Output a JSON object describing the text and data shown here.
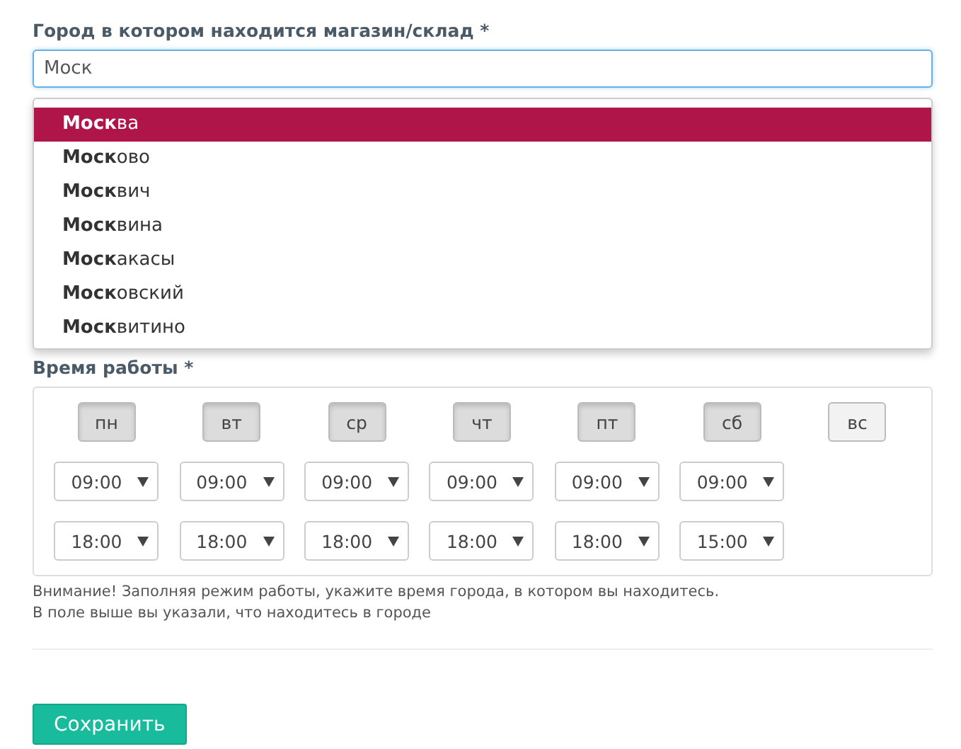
{
  "city_field": {
    "label": "Город в котором находится магазин/склад *",
    "value": "Моск"
  },
  "suggestions": [
    {
      "text": "**Моск**ва",
      "selected": true
    },
    {
      "text": "**Моск**ово",
      "selected": false
    },
    {
      "text": "**Моск**вич",
      "selected": false
    },
    {
      "text": "**Моск**вина",
      "selected": false
    },
    {
      "text": "**Моск**акасы",
      "selected": false
    },
    {
      "text": "**Моск**овский",
      "selected": false
    },
    {
      "text": "**Моск**витино",
      "selected": false
    }
  ],
  "hours": {
    "label": "Время работы *",
    "days": [
      {
        "label": "пн",
        "selected": true,
        "open": "09:00",
        "close": "18:00"
      },
      {
        "label": "вт",
        "selected": true,
        "open": "09:00",
        "close": "18:00"
      },
      {
        "label": "ср",
        "selected": true,
        "open": "09:00",
        "close": "18:00"
      },
      {
        "label": "чт",
        "selected": true,
        "open": "09:00",
        "close": "18:00"
      },
      {
        "label": "пт",
        "selected": true,
        "open": "09:00",
        "close": "18:00"
      },
      {
        "label": "сб",
        "selected": true,
        "open": "09:00",
        "close": "15:00"
      },
      {
        "label": "вс",
        "selected": false
      }
    ]
  },
  "notice": [
    "Внимание! Заполняя режим работы, укажите время города, в котором вы находитесь.",
    "В поле выше вы указали, что находитесь в городе"
  ],
  "save_button": "Сохранить"
}
